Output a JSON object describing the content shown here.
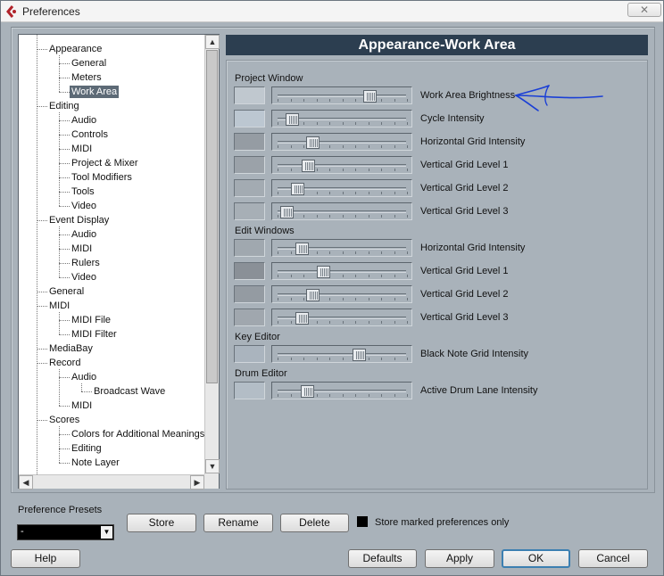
{
  "window": {
    "title": "Preferences",
    "close_glyph": "✕"
  },
  "tree": [
    {
      "label": "Appearance",
      "level": 1
    },
    {
      "label": "General",
      "level": 2
    },
    {
      "label": "Meters",
      "level": 2
    },
    {
      "label": "Work Area",
      "level": 2,
      "selected": true
    },
    {
      "label": "Editing",
      "level": 1
    },
    {
      "label": "Audio",
      "level": 2
    },
    {
      "label": "Controls",
      "level": 2
    },
    {
      "label": "MIDI",
      "level": 2
    },
    {
      "label": "Project & Mixer",
      "level": 2
    },
    {
      "label": "Tool Modifiers",
      "level": 2
    },
    {
      "label": "Tools",
      "level": 2
    },
    {
      "label": "Video",
      "level": 2
    },
    {
      "label": "Event Display",
      "level": 1
    },
    {
      "label": "Audio",
      "level": 2
    },
    {
      "label": "MIDI",
      "level": 2
    },
    {
      "label": "Rulers",
      "level": 2
    },
    {
      "label": "Video",
      "level": 2
    },
    {
      "label": "General",
      "level": 1
    },
    {
      "label": "MIDI",
      "level": 1
    },
    {
      "label": "MIDI File",
      "level": 2
    },
    {
      "label": "MIDI Filter",
      "level": 2
    },
    {
      "label": "MediaBay",
      "level": 1
    },
    {
      "label": "Record",
      "level": 1
    },
    {
      "label": "Audio",
      "level": 2
    },
    {
      "label": "Broadcast Wave",
      "level": 3
    },
    {
      "label": "MIDI",
      "level": 2
    },
    {
      "label": "Scores",
      "level": 1
    },
    {
      "label": "Colors for Additional Meanings",
      "level": 2
    },
    {
      "label": "Editing",
      "level": 2
    },
    {
      "label": "Note Layer",
      "level": 2
    }
  ],
  "panel": {
    "title": "Appearance-Work Area",
    "sections": [
      {
        "label": "Project Window",
        "rows": [
          {
            "label": "Work Area Brightness",
            "value": 0.74,
            "swatch": "#c0c8cf"
          },
          {
            "label": "Cycle Intensity",
            "value": 0.08,
            "swatch": "#bcc7d1"
          },
          {
            "label": "Horizontal Grid Intensity",
            "value": 0.26,
            "swatch": "#959ca3"
          },
          {
            "label": "Vertical Grid Level 1",
            "value": 0.22,
            "swatch": "#9ba2a9"
          },
          {
            "label": "Vertical Grid Level 2",
            "value": 0.13,
            "swatch": "#a3abb2"
          },
          {
            "label": "Vertical Grid Level 3",
            "value": 0.04,
            "swatch": "#a7afb6"
          }
        ]
      },
      {
        "label": "Edit Windows",
        "rows": [
          {
            "label": "Horizontal Grid Intensity",
            "value": 0.17,
            "swatch": "#a0a8af"
          },
          {
            "label": "Vertical Grid Level 1",
            "value": 0.35,
            "swatch": "#8a9097"
          },
          {
            "label": "Vertical Grid Level 2",
            "value": 0.26,
            "swatch": "#949ba2"
          },
          {
            "label": "Vertical Grid Level 3",
            "value": 0.17,
            "swatch": "#a0a7ae"
          }
        ]
      },
      {
        "label": "Key Editor",
        "rows": [
          {
            "label": "Black Note Grid Intensity",
            "value": 0.65,
            "swatch": "#aab4be"
          }
        ]
      },
      {
        "label": "Drum Editor",
        "rows": [
          {
            "label": "Active Drum Lane Intensity",
            "value": 0.21,
            "swatch": "#b3bdc6"
          }
        ]
      }
    ]
  },
  "presets": {
    "label": "Preference Presets",
    "selected": "-",
    "store_label": "Store",
    "rename_label": "Rename",
    "delete_label": "Delete",
    "store_marked_label": "Store marked preferences only"
  },
  "footer": {
    "help_label": "Help",
    "defaults_label": "Defaults",
    "apply_label": "Apply",
    "ok_label": "OK",
    "cancel_label": "Cancel"
  },
  "colors": {
    "window_bg": "#a9b2ba",
    "header_bg": "#2c3e50",
    "selection_bg": "#5d6a76",
    "annotation": "#1a3fd6"
  }
}
